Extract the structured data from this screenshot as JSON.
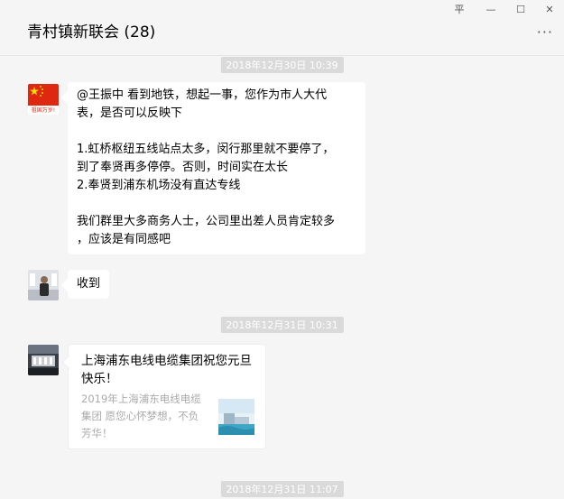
{
  "window": {
    "title": "青村镇新联会 (28)",
    "pin_glyph": "平",
    "minimize_glyph": "—",
    "maximize_glyph": "☐",
    "close_glyph": "✕",
    "more_glyph": "···"
  },
  "messages": {
    "time1": "2018年12月30日 10:39",
    "msg1_lines": [
      "@王振中   看到地铁，想起一事，您作为市人大代",
      "表，是否可以反映下",
      "",
      "1.虹桥枢纽五线站点太多，闵行那里就不要停了，",
      "到了奉贤再多停停。否则，时间实在太长",
      "2.奉贤到浦东机场没有直达专线",
      "",
      "我们群里大多商务人士，公司里出差人员肯定较多",
      "，应该是有同感吧"
    ],
    "avatar1_caption": "祖国万岁!",
    "msg2": "收到",
    "time2": "2018年12月31日 10:31",
    "card_title": "上海浦东电线电缆集团祝您元旦快乐！",
    "card_desc": "2019年上海浦东电线电缆集团 愿您心怀梦想，不负芳华！",
    "time3": "2018年12月31日 11:07"
  },
  "colors": {
    "background": "#f5f5f5",
    "bubble": "#ffffff",
    "timestamp_bg": "#dadada",
    "flag_red": "#de2910",
    "flag_star": "#ffde00"
  }
}
